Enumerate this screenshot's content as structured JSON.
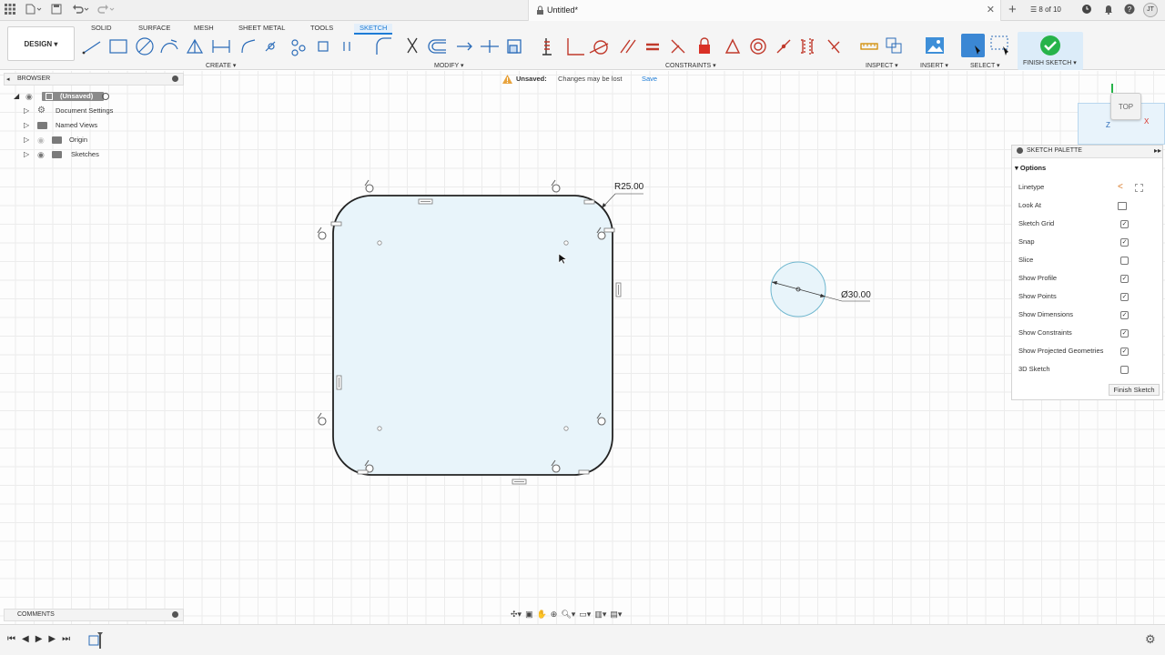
{
  "window": {
    "title": "Untitled*",
    "job_status": "8 of 10",
    "user_initials": "JT"
  },
  "workspace": {
    "mode": "DESIGN",
    "tabs": [
      "SOLID",
      "SURFACE",
      "MESH",
      "SHEET METAL",
      "TOOLS",
      "SKETCH"
    ],
    "active_tab": "SKETCH",
    "groups": {
      "create": "CREATE",
      "modify": "MODIFY",
      "constraints": "CONSTRAINTS",
      "inspect": "INSPECT",
      "insert": "INSERT",
      "select": "SELECT",
      "finish": "FINISH SKETCH"
    }
  },
  "unsaved_banner": {
    "label": "Unsaved:",
    "message": "Changes may be lost",
    "action": "Save"
  },
  "browser": {
    "title": "BROWSER",
    "root": "(Unsaved)",
    "items": [
      {
        "label": "Document Settings",
        "icon": "gear-icon"
      },
      {
        "label": "Named Views",
        "icon": "folder-icon"
      },
      {
        "label": "Origin",
        "icon": "folder-icon"
      },
      {
        "label": "Sketches",
        "icon": "folder-icon"
      }
    ]
  },
  "comments": {
    "title": "COMMENTS"
  },
  "view_cube": {
    "face": "TOP",
    "axis_x": "X",
    "axis_z": "Z"
  },
  "sketch": {
    "radius_label": "R25.00",
    "diameter_label": "Ø30.00"
  },
  "palette": {
    "title": "SKETCH PALETTE",
    "section": "Options",
    "options": [
      {
        "label": "Linetype",
        "kind": "linetype"
      },
      {
        "label": "Look At",
        "kind": "lookat"
      },
      {
        "label": "Sketch Grid",
        "checked": true
      },
      {
        "label": "Snap",
        "checked": true
      },
      {
        "label": "Slice",
        "checked": false
      },
      {
        "label": "Show Profile",
        "checked": true
      },
      {
        "label": "Show Points",
        "checked": true
      },
      {
        "label": "Show Dimensions",
        "checked": true
      },
      {
        "label": "Show Constraints",
        "checked": true
      },
      {
        "label": "Show Projected Geometries",
        "checked": true
      },
      {
        "label": "3D Sketch",
        "checked": false
      }
    ],
    "finish_button": "Finish Sketch"
  },
  "colors": {
    "accent": "#1c7bd6",
    "profile_fill": "#e8f4fa",
    "finish_green": "#27b34a",
    "constraint_red": "#d93025"
  }
}
